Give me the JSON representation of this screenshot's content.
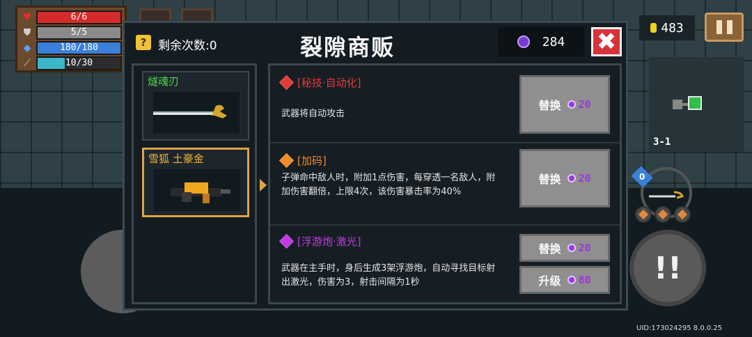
{
  "hud": {
    "hp": "6/6",
    "armor": "5/5",
    "energy": "180/180",
    "cooldown": "10/30",
    "cooldown_fraction": 0.33,
    "coins": "483",
    "level": "3-1",
    "weapon_badge": "0",
    "uid": "UID:173024295 8.0.0.25",
    "colors": {
      "hp": "#d52b2b",
      "armor": "#8a8a8a",
      "energy": "#3a7fd8",
      "cooldown": "#3bb7c9"
    }
  },
  "shop": {
    "remaining_label": "剩余次数:0",
    "hint_icon": "?",
    "title": "裂隙商贩",
    "gems": "284",
    "close_icon": "✖",
    "weapons": [
      {
        "name": "燧魂刃",
        "color": "#4ed84e",
        "icon": "sword-icon"
      },
      {
        "name": "雪狐 土豪金",
        "color": "#f0b23a",
        "icon": "gun-icon"
      }
    ],
    "items": [
      {
        "title": "[秘技·自动化]",
        "title_color": "#e23a3a",
        "gem_color": "#e23a3a",
        "desc": "武器将自动攻击",
        "buttons": [
          {
            "label": "替换",
            "cost": "20"
          }
        ]
      },
      {
        "title": "[加码]",
        "title_color": "#f08a2a",
        "gem_color": "#f08a2a",
        "desc": "子弹命中敌人时，附加1点伤害，每穿透一名敌人，附加伤害翻倍，上限4次，该伤害暴击率为40%",
        "buttons": [
          {
            "label": "替换",
            "cost": "20"
          }
        ]
      },
      {
        "title": "[浮游炮·激光]",
        "title_color": "#c23ae0",
        "gem_color": "#c23ae0",
        "desc": "武器在主手时，身后生成3架浮游炮，自动寻找目标射出激光，伤害为3，射击间隔为1秒",
        "buttons": [
          {
            "label": "替换",
            "cost": "20"
          },
          {
            "label": "升级",
            "cost": "80"
          }
        ]
      }
    ]
  }
}
